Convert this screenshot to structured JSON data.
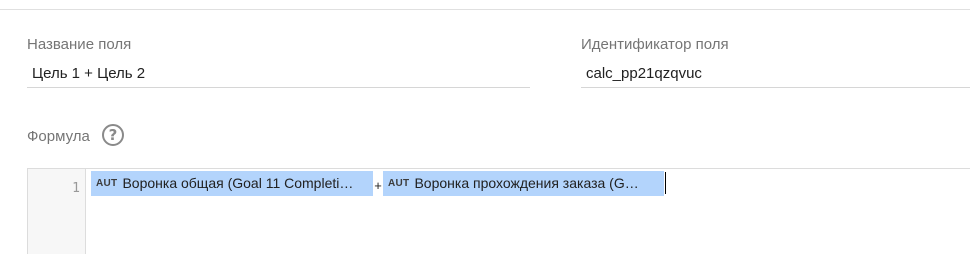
{
  "field_name": {
    "label": "Название поля",
    "value": "Цель 1 + Цель 2"
  },
  "field_id": {
    "label": "Идентификатор поля",
    "value": "calc_pp21qzqvuc"
  },
  "formula": {
    "label": "Формула",
    "help_icon": "?",
    "line_number": "1",
    "tokens": [
      {
        "tag": "AUT",
        "text": "Воронка общая (Goal 11 Completi…"
      },
      {
        "operator": "+"
      },
      {
        "tag": "AUT",
        "text": "Воронка прохождения заказа (G…"
      }
    ]
  }
}
